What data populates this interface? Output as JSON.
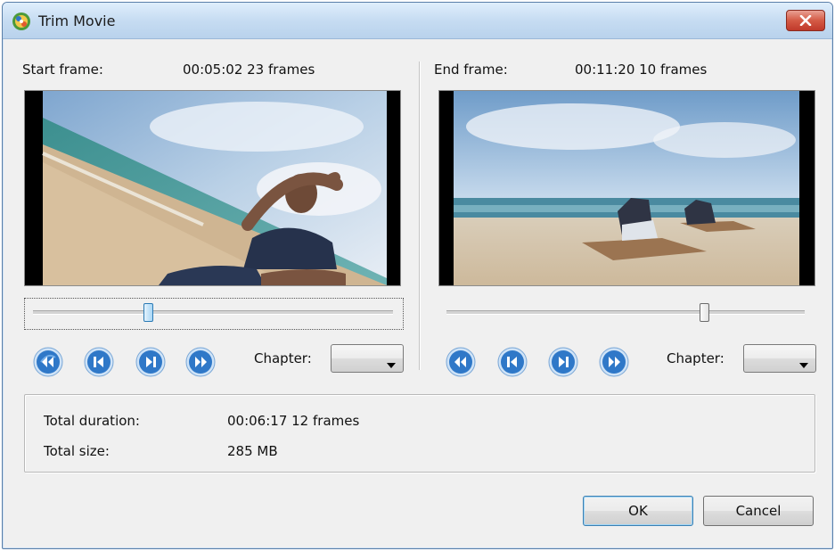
{
  "window": {
    "title": "Trim Movie",
    "close_icon": "close-icon",
    "app_icon": "movie-app-icon"
  },
  "start": {
    "label": "Start frame:",
    "time": "00:05:02 23 frames",
    "slider_position": 0.32,
    "chapter_label": "Chapter:",
    "chapter_value": ""
  },
  "end": {
    "label": "End frame:",
    "time": "00:11:20 10 frames",
    "slider_position": 0.72,
    "chapter_label": "Chapter:",
    "chapter_value": ""
  },
  "nav_icons": [
    "first-frame-icon",
    "previous-frame-icon",
    "next-frame-icon",
    "last-frame-icon"
  ],
  "summary": {
    "duration_label": "Total duration:",
    "duration_value": "00:06:17 12 frames",
    "size_label": "Total size:",
    "size_value": "285 MB"
  },
  "buttons": {
    "ok": "OK",
    "cancel": "Cancel"
  },
  "colors": {
    "nav_button_blue": "#2f78c8",
    "accent": "#3c7fb1",
    "close_red": "#c0392b"
  }
}
